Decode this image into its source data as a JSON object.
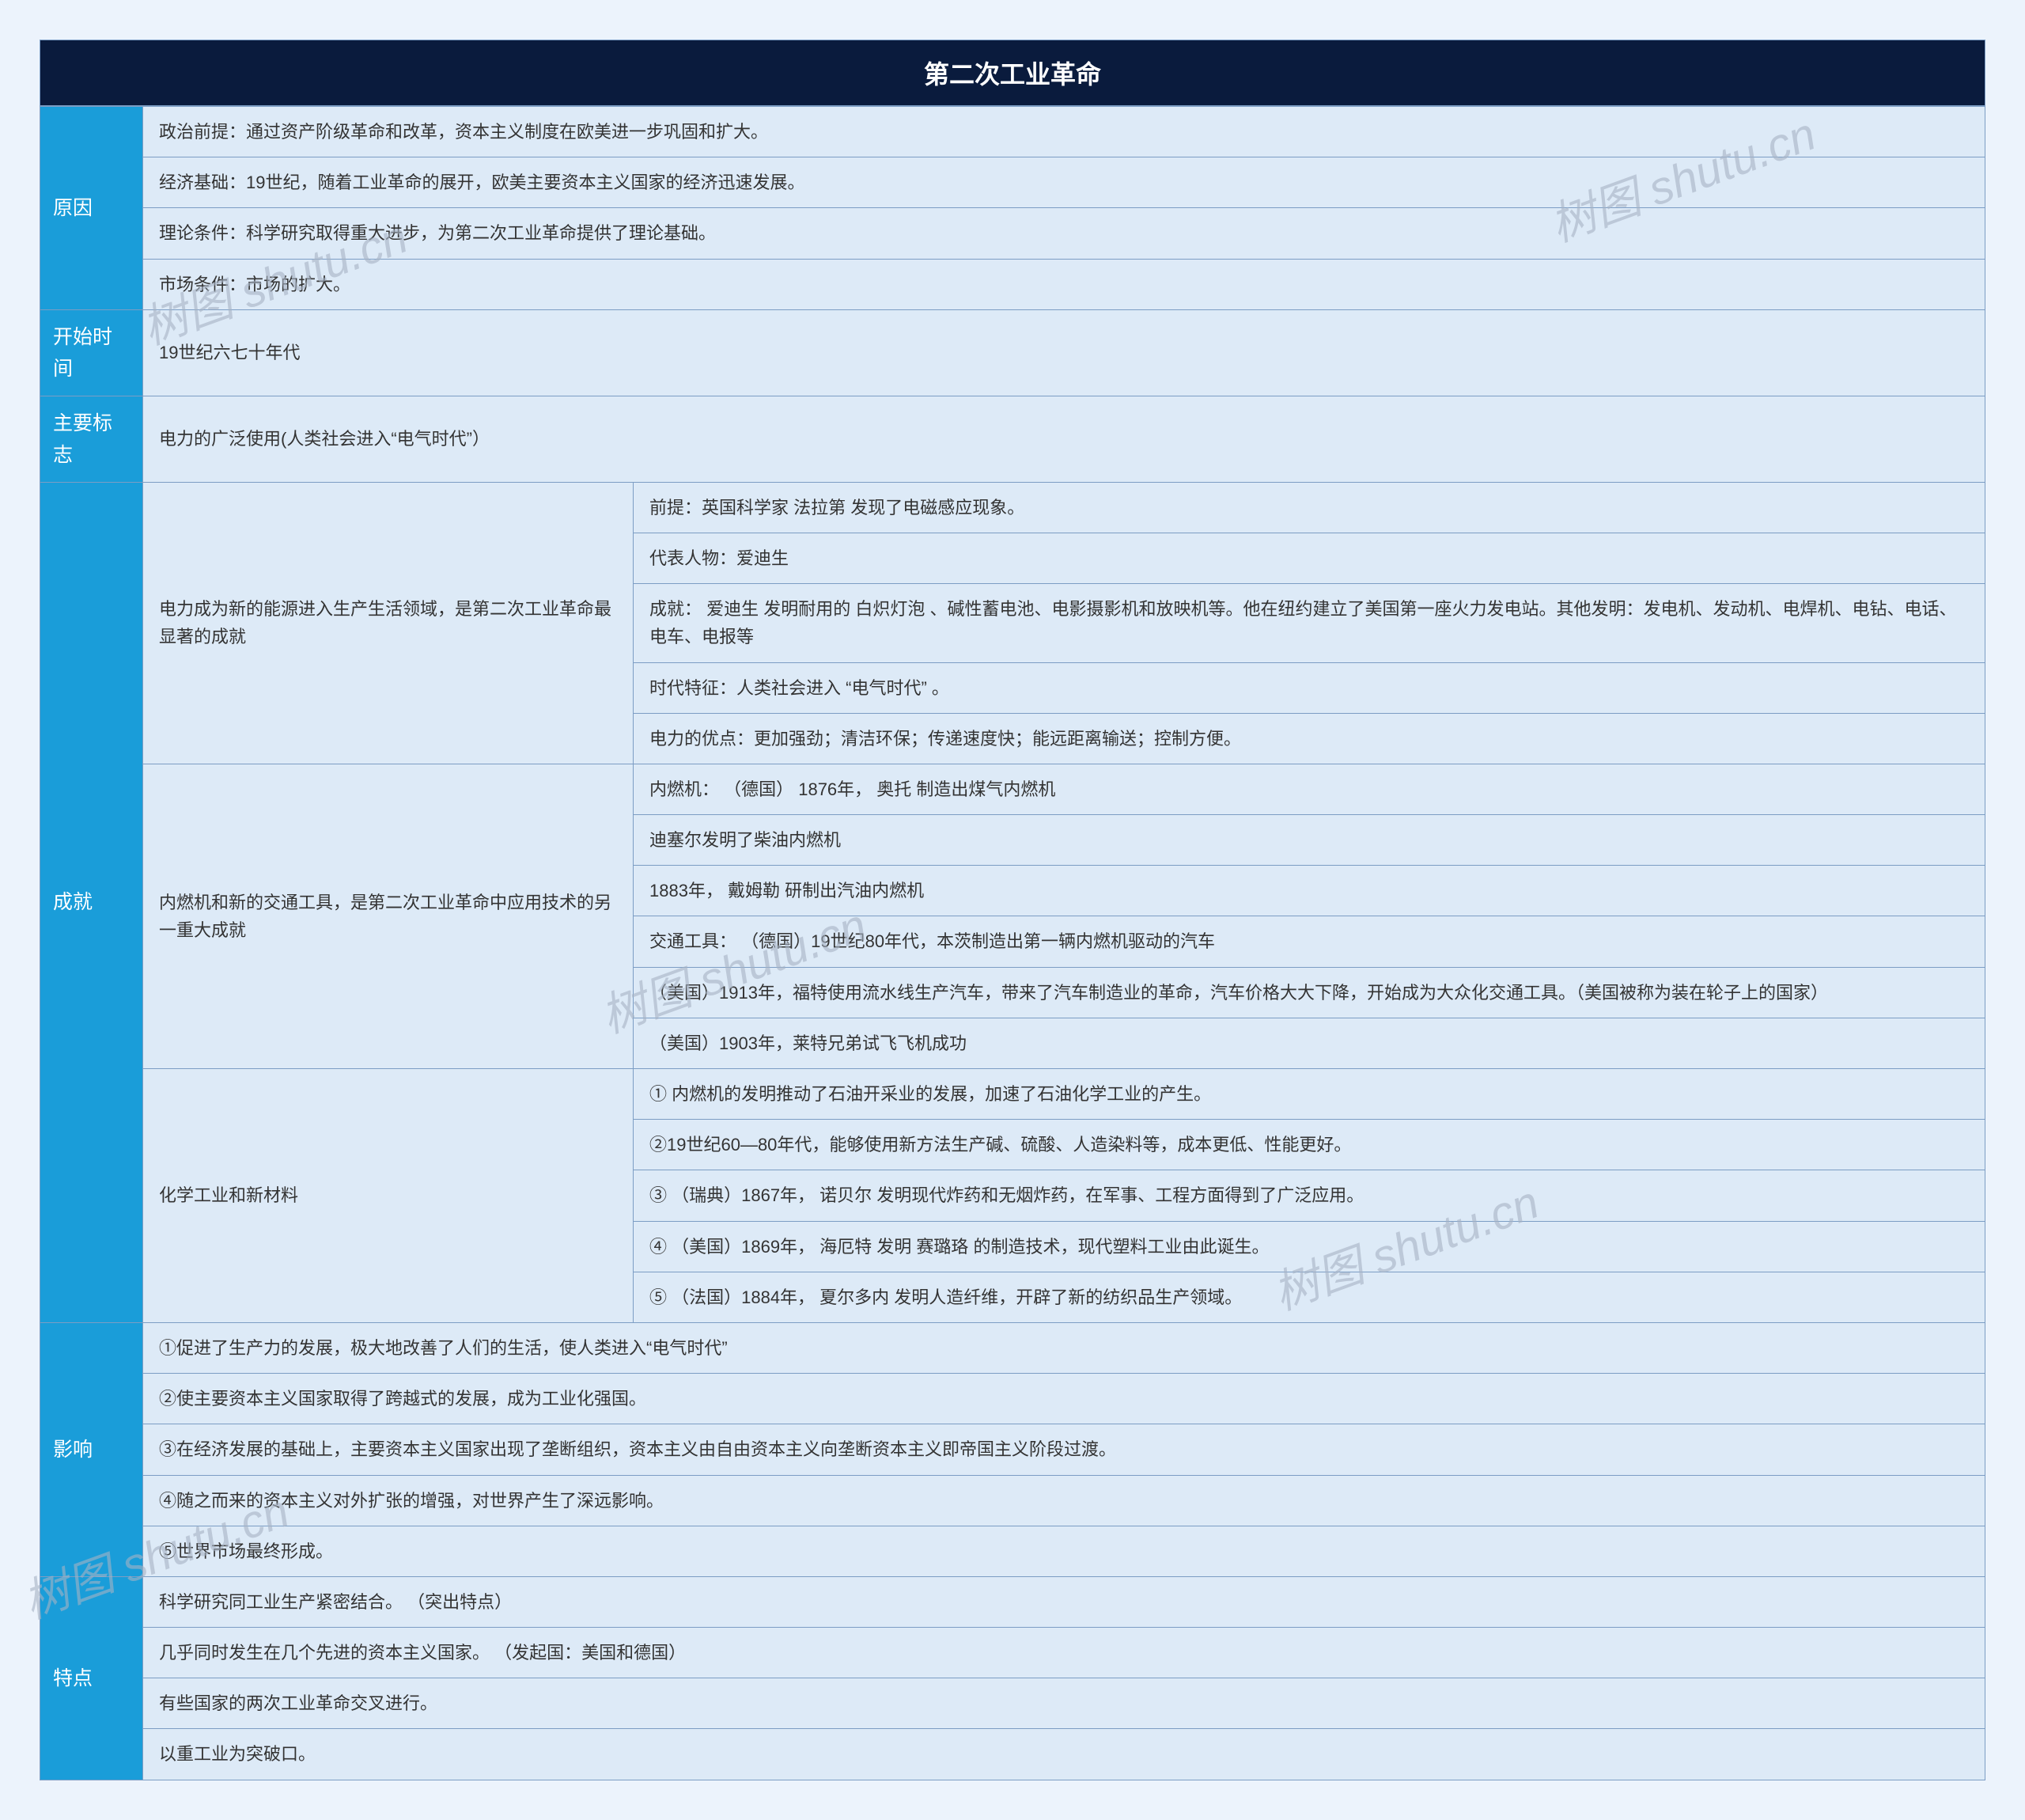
{
  "title": "第二次工业革命",
  "sections": {
    "cause": {
      "label": "原因",
      "items": [
        "政治前提：通过资产阶级革命和改革，资本主义制度在欧美进一步巩固和扩大。",
        "经济基础：19世纪，随着工业革命的展开，欧美主要资本主义国家的经济迅速发展。",
        "理论条件：科学研究取得重大进步，为第二次工业革命提供了理论基础。",
        "市场条件：市场的扩大。"
      ]
    },
    "start": {
      "label": "开始时间",
      "value": "19世纪六七十年代"
    },
    "sign": {
      "label": "主要标志",
      "value": "电力的广泛使用(人类社会进入“电气时代”）"
    },
    "achieve": {
      "label": "成就",
      "groups": [
        {
          "sub": "电力成为新的能源进入生产生活领域，是第二次工业革命最显著的成就",
          "items": [
            "前提：英国科学家 法拉第 发现了电磁感应现象。",
            "代表人物：爱迪生",
            "成就： 爱迪生 发明耐用的 白炽灯泡 、碱性蓄电池、电影摄影机和放映机等。他在纽约建立了美国第一座火力发电站。其他发明：发电机、发动机、电焊机、电钻、电话、电车、电报等",
            "时代特征：人类社会进入 “电气时代” 。",
            "电力的优点：更加强劲；清洁环保；传递速度快；能远距离输送；控制方便。"
          ]
        },
        {
          "sub": "内燃机和新的交通工具，是第二次工业革命中应用技术的另一重大成就",
          "items": [
            "内燃机： （德国） 1876年， 奥托 制造出煤气内燃机",
            "迪塞尔发明了柴油内燃机",
            "1883年， 戴姆勒 研制出汽油内燃机",
            "交通工具： （德国）19世纪80年代，本茨制造出第一辆内燃机驱动的汽车",
            " （美国）1913年，福特使用流水线生产汽车，带来了汽车制造业的革命，汽车价格大大下降，开始成为大众化交通工具。（美国被称为装在轮子上的国家）",
            " （美国）1903年，莱特兄弟试飞飞机成功"
          ]
        },
        {
          "sub": "化学工业和新材料",
          "items": [
            "① 内燃机的发明推动了石油开采业的发展，加速了石油化学工业的产生。",
            "②19世纪60—80年代，能够使用新方法生产碱、硫酸、人造染料等，成本更低、性能更好。",
            "③ （瑞典）1867年， 诺贝尔 发明现代炸药和无烟炸药，在军事、工程方面得到了广泛应用。",
            "④ （美国）1869年， 海厄特 发明 赛璐珞 的制造技术，现代塑料工业由此诞生。",
            "⑤ （法国）1884年， 夏尔多内 发明人造纤维，开辟了新的纺织品生产领域。"
          ]
        }
      ]
    },
    "impact": {
      "label": "影响",
      "items": [
        "①促进了生产力的发展，极大地改善了人们的生活，使人类进入“电气时代”",
        "②使主要资本主义国家取得了跨越式的发展，成为工业化强国。",
        "③在经济发展的基础上，主要资本主义国家出现了垄断组织，资本主义由自由资本主义向垄断资本主义即帝国主义阶段过渡。",
        "④随之而来的资本主义对外扩张的增强，对世界产生了深远影响。",
        "⑤世界市场最终形成。"
      ]
    },
    "feature": {
      "label": "特点",
      "items": [
        "科学研究同工业生产紧密结合。 （突出特点）",
        "几乎同时发生在几个先进的资本主义国家。 （发起国：美国和德国）",
        "有些国家的两次工业革命交叉进行。",
        "以重工业为突破口。"
      ]
    }
  },
  "watermark": "树图 shutu.cn"
}
